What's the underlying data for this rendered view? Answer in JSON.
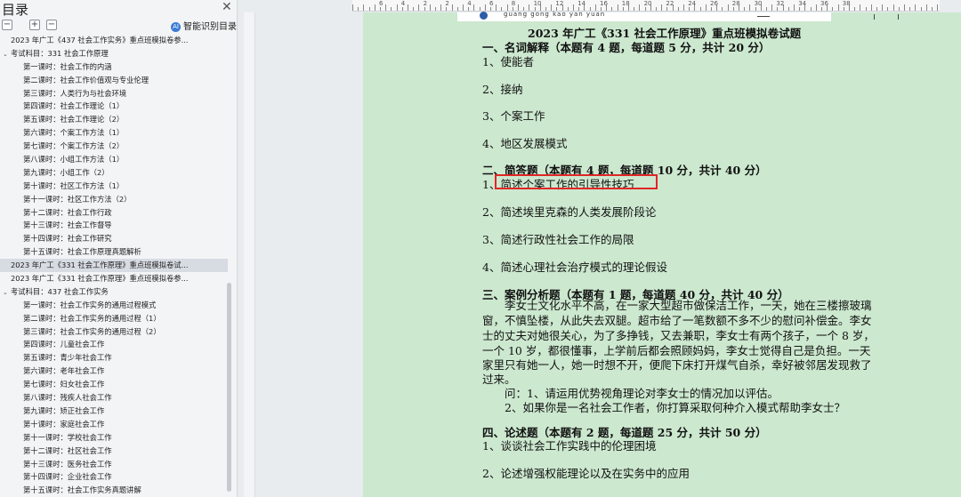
{
  "nav": {
    "title": "目录",
    "close_icon": "close-icon",
    "toolbar": {
      "collapse": "−",
      "expand": "+",
      "remove": "−",
      "smart_label": "智能识别目录"
    },
    "items": [
      {
        "text": "2023 年广工《437 社会工作实务》重点班模拟卷参...",
        "level": "l1"
      },
      {
        "text": "考试科目：331 社会工作原理",
        "level": "lc",
        "arrow": "⌄"
      },
      {
        "text": "第一课时：社会工作的内涵",
        "level": "l2"
      },
      {
        "text": "第二课时：社会工作价值观与专业伦理",
        "level": "l2"
      },
      {
        "text": "第三课时：人类行为与社会环境",
        "level": "l2"
      },
      {
        "text": "第四课时：社会工作理论（1）",
        "level": "l2"
      },
      {
        "text": "第五课时：社会工作理论（2）",
        "level": "l2"
      },
      {
        "text": "第六课时：个案工作方法（1）",
        "level": "l2"
      },
      {
        "text": "第七课时：个案工作方法（2）",
        "level": "l2"
      },
      {
        "text": "第八课时：小组工作方法（1）",
        "level": "l2"
      },
      {
        "text": "第九课时：小组工作（2）",
        "level": "l2"
      },
      {
        "text": "第十课时：社区工作方法（1）",
        "level": "l2"
      },
      {
        "text": "第十一课时：社区工作方法（2）",
        "level": "l2"
      },
      {
        "text": "第十二课时：社会工作行政",
        "level": "l2"
      },
      {
        "text": "第十三课时：社会工作督导",
        "level": "l2"
      },
      {
        "text": "第十四课时：社会工作研究",
        "level": "l2"
      },
      {
        "text": "第十五课时：社会工作原理真题解析",
        "level": "l2"
      },
      {
        "text": "2023 年广工《331 社会工作原理》重点班模拟卷试...",
        "level": "l1",
        "selected": true
      },
      {
        "text": "2023 年广工《331 社会工作原理》重点班模拟卷参...",
        "level": "l1"
      },
      {
        "text": "考试科目：437 社会工作实务",
        "level": "lc",
        "arrow": "⌄"
      },
      {
        "text": "第一课时：社会工作实务的通用过程模式",
        "level": "l2"
      },
      {
        "text": "第二课时：社会工作实务的通用过程（1）",
        "level": "l2"
      },
      {
        "text": "第三课时：社会工作实务的通用过程（2）",
        "level": "l2"
      },
      {
        "text": "第四课时：儿童社会工作",
        "level": "l2"
      },
      {
        "text": "第五课时：青少年社会工作",
        "level": "l2"
      },
      {
        "text": "第六课时：老年社会工作",
        "level": "l2"
      },
      {
        "text": "第七课时：妇女社会工作",
        "level": "l2"
      },
      {
        "text": "第八课时：残疾人社会工作",
        "level": "l2"
      },
      {
        "text": "第九课时：矫正社会工作",
        "level": "l2"
      },
      {
        "text": "第十课时：家庭社会工作",
        "level": "l2"
      },
      {
        "text": "第十一课时：学校社会工作",
        "level": "l2"
      },
      {
        "text": "第十二课时：社区社会工作",
        "level": "l2"
      },
      {
        "text": "第十三课时：医务社会工作",
        "level": "l2"
      },
      {
        "text": "第十四课时：企业社会工作",
        "level": "l2"
      },
      {
        "text": "第十五课时：社会工作实务真题讲解",
        "level": "l2"
      }
    ]
  },
  "ruler": {
    "numbers": [
      "6",
      "4",
      "2",
      "2",
      "4",
      "6",
      "8",
      "10",
      "12",
      "14",
      "16",
      "18",
      "20",
      "22",
      "24",
      "26",
      "28",
      "30",
      "32",
      "34",
      "36",
      "38"
    ]
  },
  "header": {
    "pinyin": "guang gong kao yan yuan"
  },
  "doc": {
    "title": "2023 年广工《331 社会工作原理》重点班模拟卷试题",
    "s1": "一、名词解释（本题有 4 题，每道题 5 分，共计 20 分）",
    "s1_items": [
      "1、使能者",
      "2、接纳",
      "3、个案工作",
      "4、地区发展模式"
    ],
    "s2": "二、简答题（本题有 4 题，每道题 10 分，共计 40 分）",
    "s2_items": [
      "1、简述个案工作的引导性技巧",
      "2、简述埃里克森的人类发展阶段论",
      "3、简述行政性社会工作的局限",
      "4、简述心理社会治疗模式的理论假设"
    ],
    "s3": "三、案例分析题（本题有 1 题，每道题 40 分，共计 40 分）",
    "case_lines": [
      "　　李女士文化水平不高，在一家大型超市做保洁工作，一天，她在三楼擦玻璃",
      "窗，不慎坠楼，从此失去双腿。超市给了一笔数额不多不少的慰问补偿金。李女",
      "士的丈夫对她很关心，为了多挣钱，又去兼职，李女士有两个孩子，一个 8 岁，",
      "一个 10 岁，都很懂事，上学前后都会照顾妈妈，李女士觉得自己是负担。一天",
      "家里只有她一人，她一时想不开，便爬下床打开煤气自杀，幸好被邻居发现救了",
      "过来。"
    ],
    "q1": "　　问：1、请运用优势视角理论对李女士的情况加以评估。",
    "q2": "　　2、如果你是一名社会工作者，你打算采取何种介入模式帮助李女士？",
    "s4": "四、论述题（本题有 2 题，每道题 25 分，共计 50 分）",
    "s4_items": [
      "1、谈谈社会工作实践中的伦理困境",
      "2、论述增强权能理论以及在实务中的应用"
    ]
  }
}
